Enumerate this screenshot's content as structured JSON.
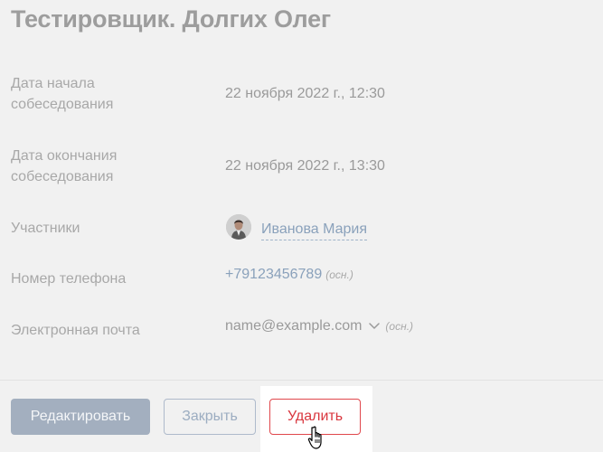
{
  "page": {
    "title": "Тестировщик. Долгих Олег"
  },
  "fields": {
    "start": {
      "label": "Дата начала собеседования",
      "value": "22 ноября 2022 г., 12:30"
    },
    "end": {
      "label": "Дата окончания собеседования",
      "value": "22 ноября 2022 г., 13:30"
    },
    "participants": {
      "label": "Участники",
      "value": "Иванова Мария"
    },
    "phone": {
      "label": "Номер телефона",
      "value": "+79123456789",
      "tag": "(осн.)"
    },
    "email": {
      "label": "Электронная почта",
      "value": "name@example.com",
      "tag": "(осн.)"
    }
  },
  "buttons": {
    "edit": "Редактировать",
    "close": "Закрыть",
    "delete": "Удалить"
  },
  "colors": {
    "accent": "#8aa1bb",
    "danger": "#d9363e",
    "primary_button": "#a3afbf",
    "background": "#f1f1f1"
  },
  "icons": {
    "avatar": "user-avatar",
    "chevron": "chevron-down-icon",
    "cursor": "hand-pointer-icon"
  }
}
